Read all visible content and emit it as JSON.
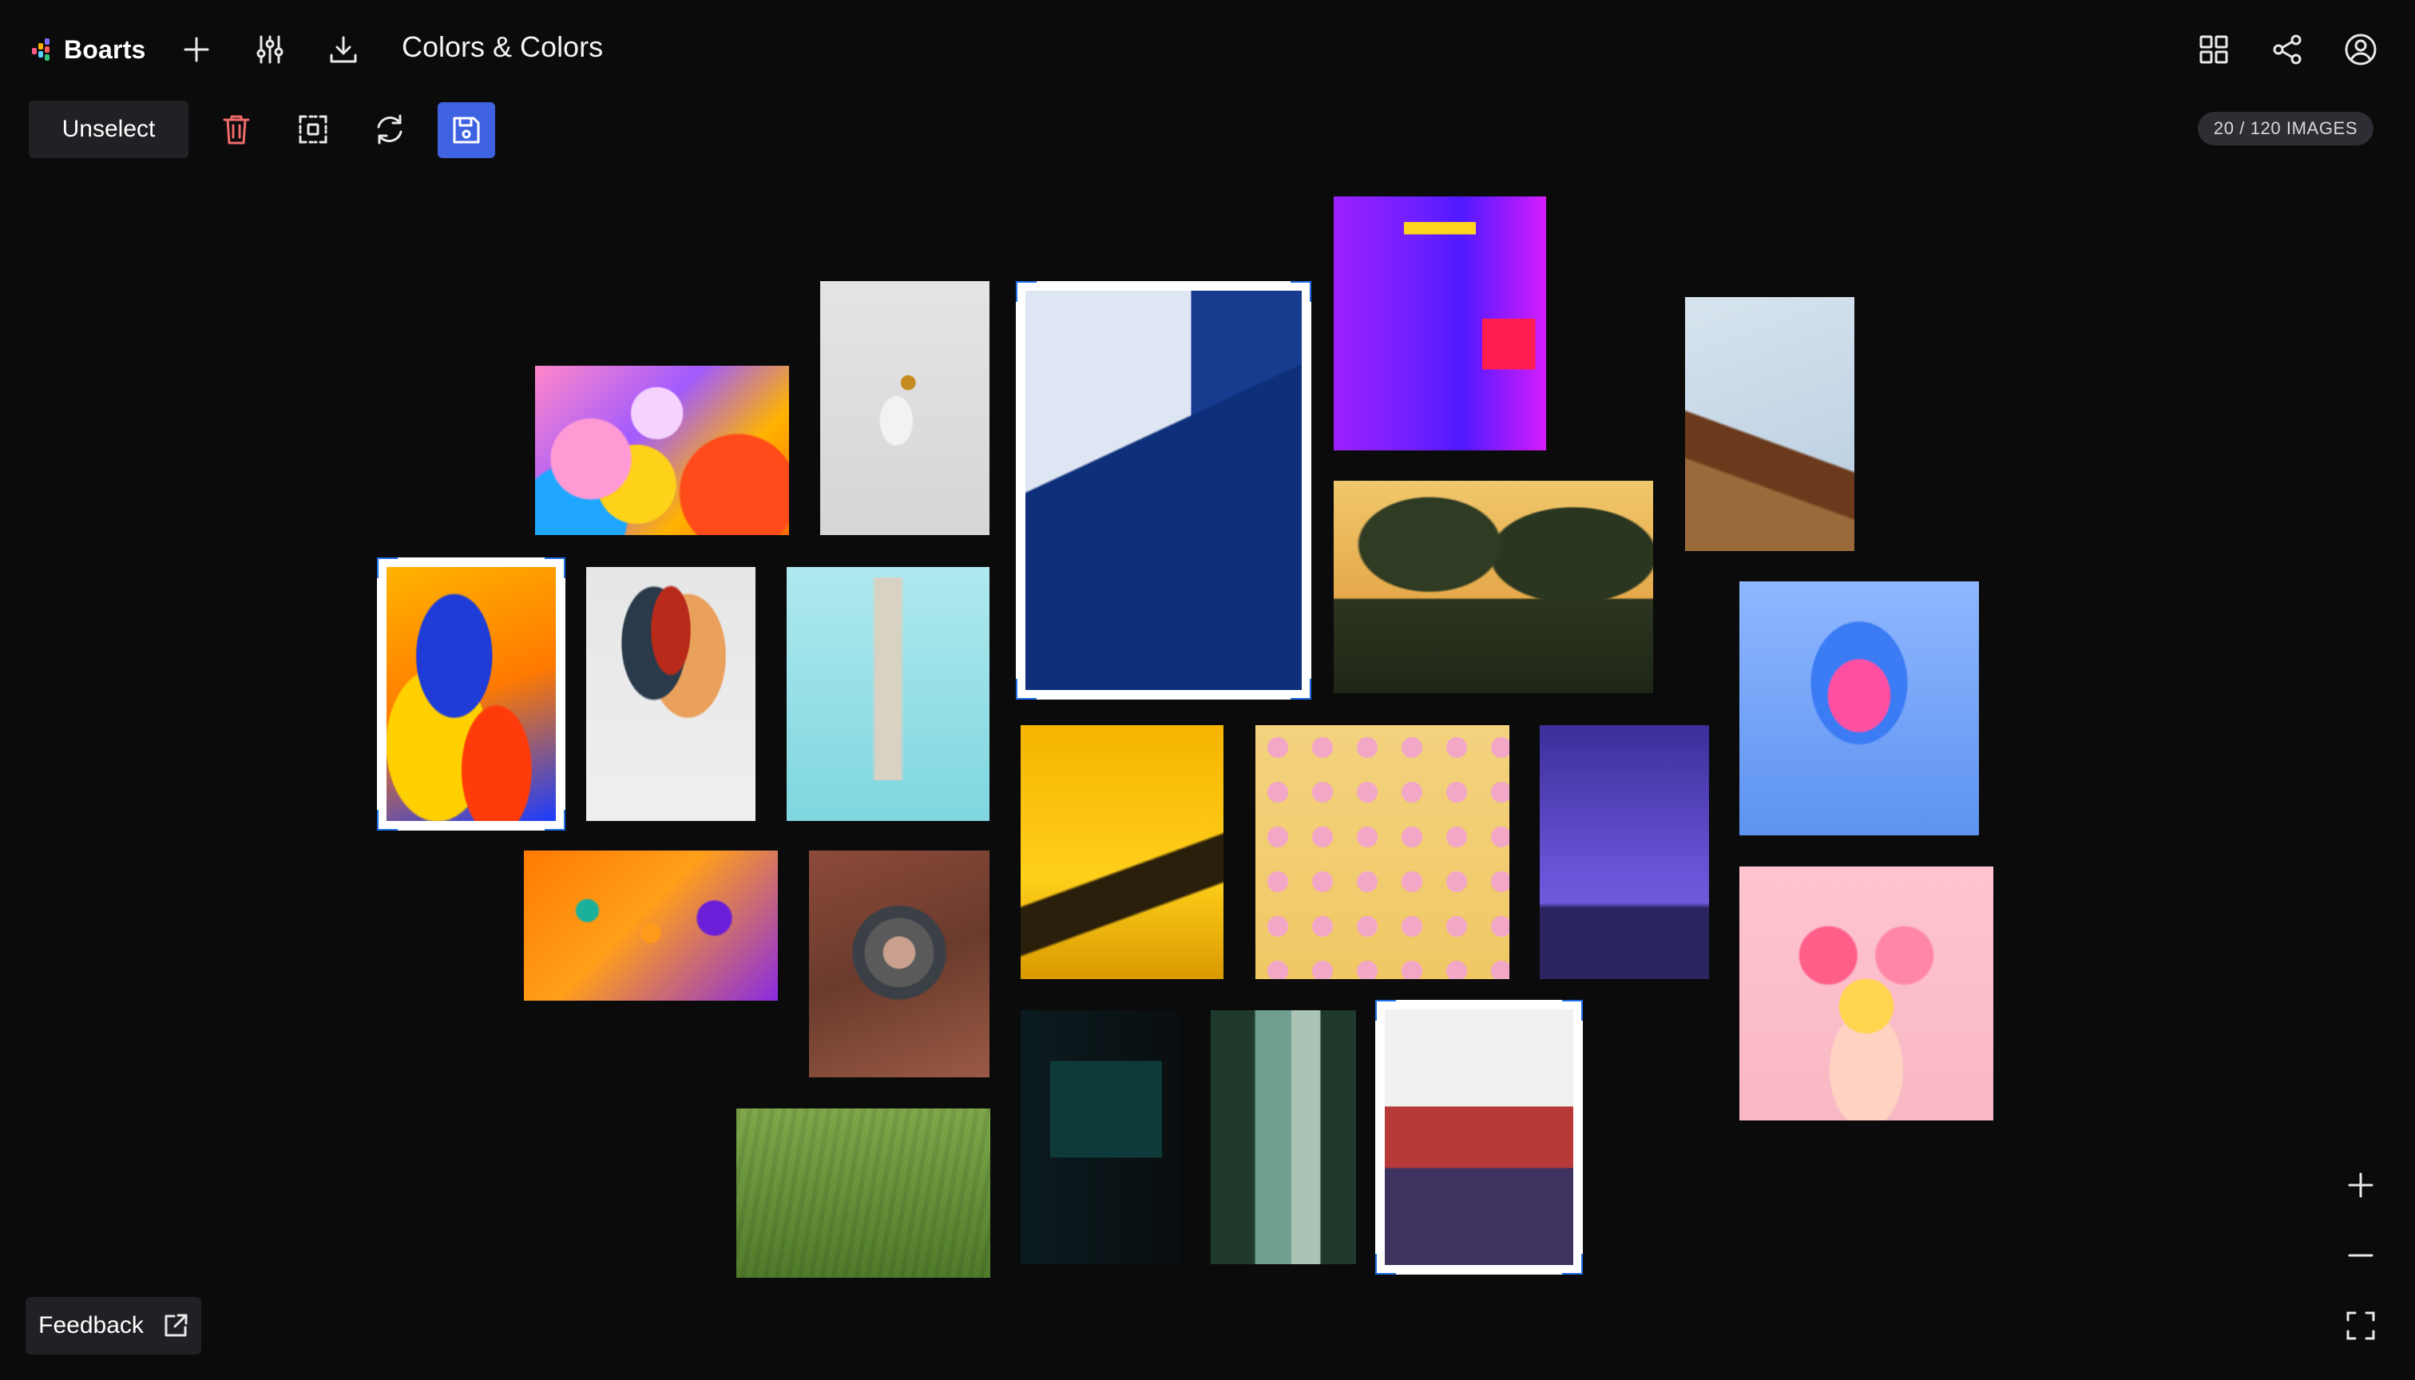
{
  "app": {
    "name": "Boarts"
  },
  "header": {
    "board_title": "Colors & Colors",
    "icons": {
      "add": "plus-icon",
      "filters": "sliders-icon",
      "download": "download-icon",
      "grid": "grid-icon",
      "share": "share-icon",
      "account": "user-circle-icon"
    }
  },
  "toolbar": {
    "unselect_label": "Unselect",
    "icons": {
      "delete": "trash-icon",
      "select_area": "select-area-icon",
      "refresh": "refresh-icon",
      "save": "save-icon"
    },
    "colors": {
      "save_bg": "#3f62e0",
      "delete": "#f26b6b"
    }
  },
  "status": {
    "image_count": "20 / 120 IMAGES"
  },
  "feedback": {
    "label": "Feedback",
    "icon": "external-link-icon"
  },
  "zoom": {
    "icons": {
      "zoom_in": "plus-icon",
      "zoom_out": "minus-icon",
      "fit": "fullscreen-icon"
    }
  },
  "canvas": {
    "images": [
      {
        "id": "oil-bubbles",
        "subject": "colorful oil bubbles",
        "selected": false
      },
      {
        "id": "white-hand-sphere",
        "subject": "white hand holding golden sphere",
        "selected": false
      },
      {
        "id": "blue-stairs",
        "subject": "blue staircase building",
        "selected": true
      },
      {
        "id": "neon-corridor",
        "subject": "purple neon corridor",
        "selected": false
      },
      {
        "id": "pagoda-roof",
        "subject": "pagoda roof",
        "selected": false
      },
      {
        "id": "fluid-paint",
        "subject": "blue and yellow fluid paint",
        "selected": true
      },
      {
        "id": "ink-splash",
        "subject": "ink splash abstract",
        "selected": false
      },
      {
        "id": "burj-khalifa",
        "subject": "skyscraper against cyan sky",
        "selected": false
      },
      {
        "id": "supertrees",
        "subject": "supertree grove at sunset",
        "selected": false
      },
      {
        "id": "glitch-portrait",
        "subject": "glitch portrait",
        "selected": false
      },
      {
        "id": "orange-paint-drops",
        "subject": "orange paint drops",
        "selected": false
      },
      {
        "id": "aerial-arena",
        "subject": "aerial view of arena",
        "selected": false
      },
      {
        "id": "yellow-car",
        "subject": "yellow car detail",
        "selected": false
      },
      {
        "id": "lollipops",
        "subject": "lollipops pattern",
        "selected": false
      },
      {
        "id": "starry-night",
        "subject": "starry night over hills",
        "selected": false
      },
      {
        "id": "flower-heart",
        "subject": "hands holding flower heart",
        "selected": false
      },
      {
        "id": "grass-field",
        "subject": "green grass field",
        "selected": false
      },
      {
        "id": "neon-sign",
        "subject": "neon sign",
        "selected": false
      },
      {
        "id": "aerial-beach",
        "subject": "aerial beach with palms",
        "selected": false
      },
      {
        "id": "red-library",
        "subject": "red library shelves",
        "selected": true
      }
    ]
  }
}
